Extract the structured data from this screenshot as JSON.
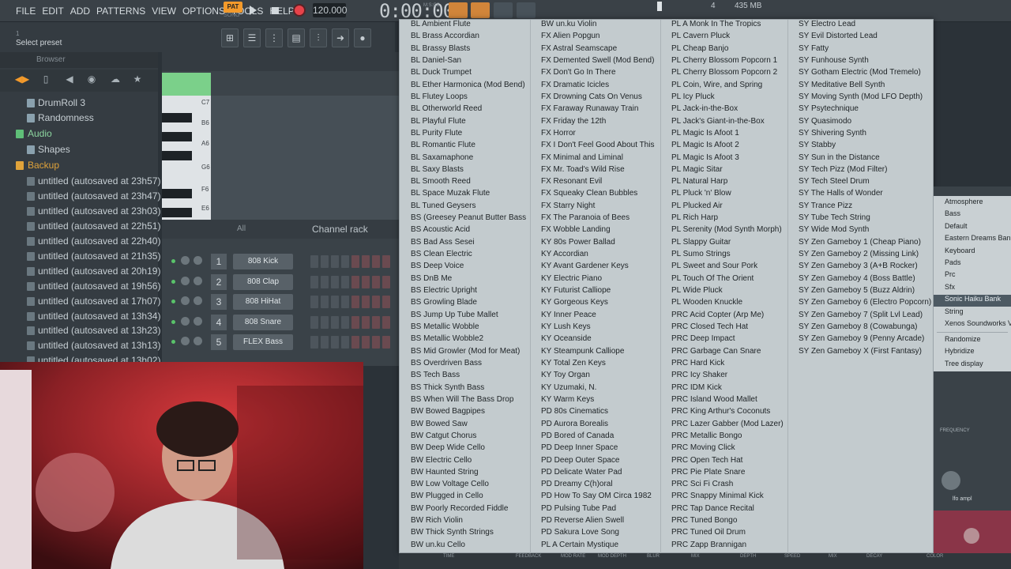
{
  "menu": [
    "FILE",
    "EDIT",
    "ADD",
    "PATTERNS",
    "VIEW",
    "OPTIONS",
    "TOOLS",
    "HELP"
  ],
  "transport": {
    "pat": "PAT",
    "song": "SONG",
    "tempo": "120.000",
    "time": "0:00:00",
    "time_unit": "M:S:CS"
  },
  "status": {
    "cpu": "4",
    "memory": "435 MB"
  },
  "hint": {
    "number": "1",
    "text": "Select preset"
  },
  "browser": {
    "title": "Browser",
    "items": [
      {
        "label": "DrumRoll 3",
        "icon": "folder-icon"
      },
      {
        "label": "Randomness",
        "icon": "folder-icon"
      },
      {
        "label": "Audio",
        "icon": "audio-icon"
      },
      {
        "label": "Shapes",
        "icon": "folder-icon"
      },
      {
        "label": "Backup",
        "icon": "backup-icon"
      },
      {
        "label": "untitled (autosaved at 23h57)",
        "icon": "file-icon"
      },
      {
        "label": "untitled (autosaved at 23h47)",
        "icon": "file-icon"
      },
      {
        "label": "untitled (autosaved at 23h03)",
        "icon": "file-icon"
      },
      {
        "label": "untitled (autosaved at 22h51)",
        "icon": "file-icon"
      },
      {
        "label": "untitled (autosaved at 22h40)",
        "icon": "file-icon"
      },
      {
        "label": "untitled (autosaved at 21h35)",
        "icon": "file-icon"
      },
      {
        "label": "untitled (autosaved at 20h19)",
        "icon": "file-icon"
      },
      {
        "label": "untitled (autosaved at 19h56)",
        "icon": "file-icon"
      },
      {
        "label": "untitled (autosaved at 17h07)",
        "icon": "file-icon"
      },
      {
        "label": "untitled (autosaved at 13h34)",
        "icon": "file-icon"
      },
      {
        "label": "untitled (autosaved at 13h23)",
        "icon": "file-icon"
      },
      {
        "label": "untitled (autosaved at 13h13)",
        "icon": "file-icon"
      },
      {
        "label": "untitled (autosaved at 13h02)",
        "icon": "file-icon"
      }
    ]
  },
  "piano_keys": [
    "C7",
    "B6",
    "A6",
    "G6",
    "F6",
    "E6"
  ],
  "channel_rack": {
    "filter": "All",
    "title": "Channel rack",
    "channels": [
      {
        "num": "1",
        "name": "808 Kick"
      },
      {
        "num": "2",
        "name": "808 Clap"
      },
      {
        "num": "3",
        "name": "808 HiHat"
      },
      {
        "num": "4",
        "name": "808 Snare"
      },
      {
        "num": "5",
        "name": "FLEX Bass"
      }
    ]
  },
  "presets": {
    "col1": [
      "BL Ambient Flute",
      "BL Brass Accordian",
      "BL Brassy Blasts",
      "BL Daniel-San",
      "BL Duck Trumpet",
      "BL Ether Harmonica (Mod Bend)",
      "BL Flutey Loops",
      "BL Otherworld Reed",
      "BL Playful Flute",
      "BL Purity Flute",
      "BL Romantic Flute",
      "BL Saxamaphone",
      "BL Saxy Blasts",
      "BL Smooth Reed",
      "BL Space Muzak Flute",
      "BL Tuned Geysers",
      "BS (Greesey Peanut Butter Bass",
      "BS Acoustic Acid",
      "BS Bad Ass Sesei",
      "BS Clean Electric",
      "BS Deep Voice",
      "BS DnB Me",
      "BS Electric Upright",
      "BS Growling Blade",
      "BS Jump Up Tube Mallet",
      "BS Metallic Wobble",
      "BS Metallic Wobble2",
      "BS Mid Growler (Mod for Meat)",
      "BS Overdriven Bass",
      "BS Tech Bass",
      "BS Thick Synth Bass",
      "BS When Will The Bass Drop",
      "BW Bowed Bagpipes",
      "BW Bowed Saw",
      "BW Catgut Chorus",
      "BW Deep Wide Cello",
      "BW Electric Cello",
      "BW Haunted String",
      "BW Low Voltage Cello",
      "BW Plugged in Cello",
      "BW Poorly Recorded Fiddle",
      "BW Rich Violin",
      "BW Thick Synth Strings",
      "BW un.ku Cello"
    ],
    "col2": [
      "BW un.ku Violin",
      "FX Alien Popgun",
      "FX Astral Seamscape",
      "FX Demented Swell (Mod Bend)",
      "FX Don't Go In There",
      "FX Dramatic Icicles",
      "FX Drowning Cats On Venus",
      "FX Faraway Runaway Train",
      "FX Friday the 12th",
      "FX Horror",
      "FX I Don't Feel Good About This",
      "FX Minimal and Liminal",
      "FX Mr. Toad's Wild Rise",
      "FX Resonant Evil",
      "FX Squeaky Clean Bubbles",
      "FX Starry Night",
      "FX The Paranoia of Bees",
      "FX Wobble Landing",
      "KY 80s Power Ballad",
      "KY Accordian",
      "KY Avant Gardener Keys",
      "KY Electric Piano",
      "KY Futurist Calliope",
      "KY Gorgeous Keys",
      "KY Inner Peace",
      "KY Lush Keys",
      "KY Oceanside",
      "KY Steampunk Calliope",
      "KY Total Zen Keys",
      "KY Toy Organ",
      "KY Uzumaki, N.",
      "KY Warm Keys",
      "PD 80s Cinematics",
      "PD Aurora Borealis",
      "PD Bored of Canada",
      "PD Deep Inner Space",
      "PD Deep Outer Space",
      "PD Delicate Water Pad",
      "PD Dreamy C(h)oral",
      "PD How To Say OM Circa 1982",
      "PD Pulsing Tube Pad",
      "PD Reverse Alien Swell",
      "PD Sakura Love Song",
      "PL A Certain Mystique"
    ],
    "col3": [
      "PL A Monk In The Tropics",
      "PL Cavern Pluck",
      "PL Cheap Banjo",
      "PL Cherry Blossom Popcorn 1",
      "PL Cherry Blossom Popcorn 2",
      "PL Coin, Wire, and Spring",
      "PL Icy Pluck",
      "PL Jack-in-the-Box",
      "PL Jack's Giant-in-the-Box",
      "PL Magic Is Afoot 1",
      "PL Magic Is Afoot 2",
      "PL Magic Is Afoot 3",
      "PL Magic Sitar",
      "PL Natural Harp",
      "PL Pluck 'n' Blow",
      "PL Plucked Air",
      "PL Rich Harp",
      "PL Serenity (Mod Synth Morph)",
      "PL Slappy Guitar",
      "PL Sumo Strings",
      "PL Sweet and Sour Pork",
      "PL Touch Of The Orient",
      "PL Wide Pluck",
      "PL Wooden Knuckle",
      "PRC Acid Copter (Arp Me)",
      "PRC Closed Tech Hat",
      "PRC Deep Impact",
      "PRC Garbage Can Snare",
      "PRC Hard Kick",
      "PRC Icy Shaker",
      "PRC IDM Kick",
      "PRC Island Wood Mallet",
      "PRC King Arthur's Coconuts",
      "PRC Lazer Gabber (Mod Lazer)",
      "PRC Metallic Bongo",
      "PRC Moving Click",
      "PRC Open Tech Hat",
      "PRC Pie Plate Snare",
      "PRC Sci Fi Crash",
      "PRC Snappy Minimal Kick",
      "PRC Tap Dance Recital",
      "PRC Tuned Bongo",
      "PRC Tuned Oil Drum",
      "PRC Zapp Brannigan"
    ],
    "col4": [
      "SY Electro Lead",
      "SY Evil Distorted Lead",
      "SY Fatty",
      "SY Funhouse Synth",
      "SY Gotham Electric (Mod Tremelo)",
      "SY Meditative Bell Synth",
      "SY Moving Synth (Mod LFO Depth)",
      "SY Psytechnique",
      "SY Quasimodo",
      "SY Shivering Synth",
      "SY Stabby",
      "SY Sun in the Distance",
      "SY Tech Pizz (Mod Filter)",
      "SY Tech Steel Drum",
      "SY The Halls of Wonder",
      "SY Trance Pizz",
      "SY Tube Tech String",
      "SY Wide Mod Synth",
      "SY Zen Gameboy 1 (Cheap Piano)",
      "SY Zen Gameboy 2 (Missing Link)",
      "SY Zen Gameboy 3 (A+B Rocker)",
      "SY Zen Gameboy 4 (Boss Battle)",
      "SY Zen Gameboy 5 (Buzz Aldrin)",
      "SY Zen Gameboy 6 (Electro Popcorn)",
      "SY Zen Gameboy 7 (Split Lvl Lead)",
      "SY Zen Gameboy 8 (Cowabunga)",
      "SY Zen Gameboy 9 (Penny Arcade)",
      "SY Zen Gameboy X (First Fantasy)"
    ]
  },
  "side_menu": {
    "categories": [
      "Atmosphere",
      "Bass",
      "Default",
      "Eastern Dreams Bank",
      "Keyboard",
      "Pads",
      "Prc",
      "Sfx",
      "Sonic Haiku Bank",
      "String",
      "Xenos Soundworks V"
    ],
    "selected": "Sonic Haiku Bank",
    "actions": [
      "Randomize",
      "Hybridize",
      "Tree display"
    ]
  },
  "plugin_labels": {
    "frequency": "FREQUENCY",
    "lfo_ampl": "lfo ampl"
  },
  "bottom_labels": [
    "TIME",
    "FEEDBACK",
    "MOD RATE",
    "MOD DEPTH",
    "BLUR",
    "MIX",
    "DEPTH",
    "SPEED",
    "MIX",
    "DECAY",
    "COLOR"
  ],
  "colors": {
    "accent": "#f39a2b",
    "record": "#e8434a",
    "menu_bg": "#c3cbce",
    "selected_bg": "#4d5a63"
  }
}
